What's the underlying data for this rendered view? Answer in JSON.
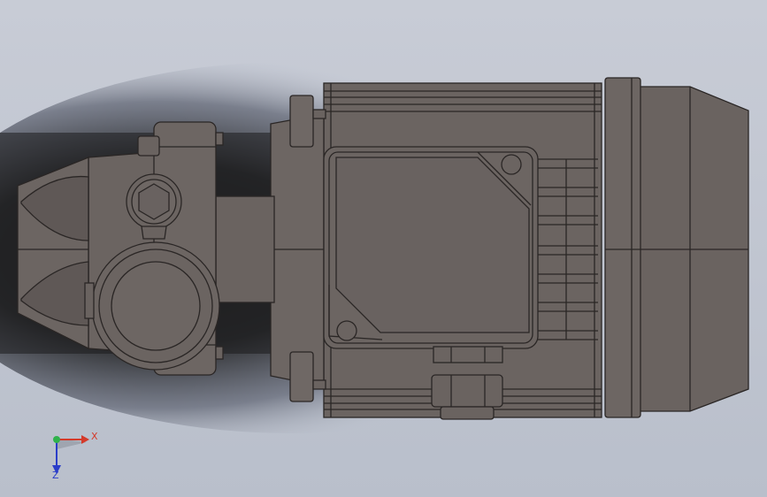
{
  "viewport": {
    "background_colors": [
      "#2b2b2b",
      "#7d8491",
      "#c3c8d3"
    ],
    "model_fill": "#6b6461",
    "model_edge": "#2a2625"
  },
  "triad": {
    "x_label": "X",
    "z_label": "Z",
    "x_color": "#d43a2a",
    "y_color": "#2fb24b",
    "z_color": "#2a3dc9"
  }
}
